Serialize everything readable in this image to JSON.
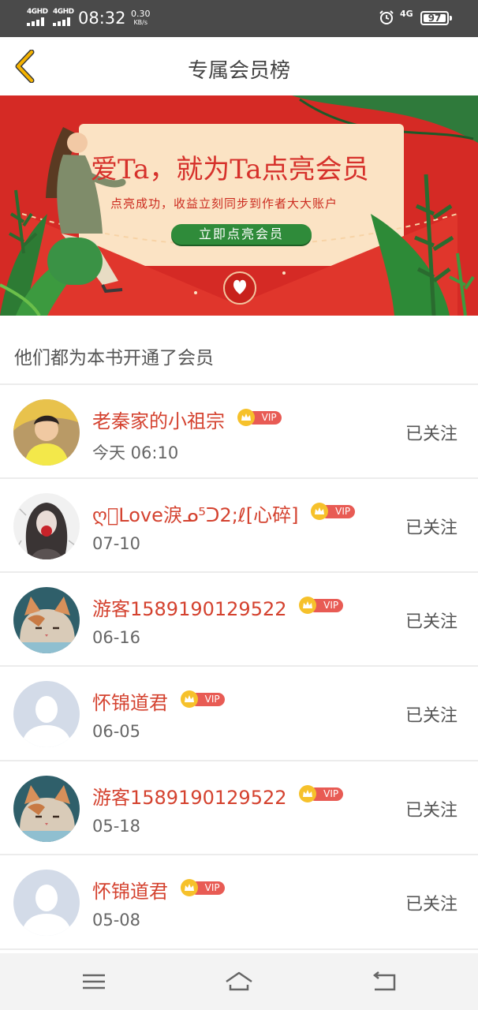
{
  "status_bar": {
    "network_1": "4GHD",
    "network_2": "4GHD",
    "time": "08:32",
    "speed_value": "0.30",
    "speed_unit": "KB/s",
    "network_3": "4G",
    "battery": "97",
    "icons": [
      "signal-icon",
      "alarm-icon",
      "battery-icon"
    ]
  },
  "header": {
    "title": "专属会员榜",
    "back_icon": "chevron-left-icon",
    "accent_color": "#f5b300"
  },
  "banner": {
    "headline": "爱Ta，就为Ta点亮会员",
    "subtitle": "点亮成功，收益立刻同步到作者大大账户",
    "button_label": "立即点亮会员",
    "background_color": "#d52a25",
    "button_color": "#2f8b3a"
  },
  "members": {
    "section_title": "他们都为本书开通了会员",
    "vip_label": "VIP",
    "items": [
      {
        "name": "老秦家的小祖宗",
        "date": "今天 06:10",
        "follow": "已关注",
        "avatar": "photo-avatar"
      },
      {
        "name": "ღ⃢Love淚ᓄ⁵ᑐ2;ℓ[心碎]",
        "date": "07-10",
        "follow": "已关注",
        "avatar": "illustration-avatar"
      },
      {
        "name": "游客1589190129522",
        "date": "06-16",
        "follow": "已关注",
        "avatar": "cat-avatar"
      },
      {
        "name": "怀锦道君",
        "date": "06-05",
        "follow": "已关注",
        "avatar": "default-avatar"
      },
      {
        "name": "游客1589190129522",
        "date": "05-18",
        "follow": "已关注",
        "avatar": "cat-avatar"
      },
      {
        "name": "怀锦道君",
        "date": "05-08",
        "follow": "已关注",
        "avatar": "default-avatar"
      }
    ]
  },
  "nav_bar": {
    "icons": [
      "menu-icon",
      "home-icon",
      "back-icon"
    ]
  }
}
